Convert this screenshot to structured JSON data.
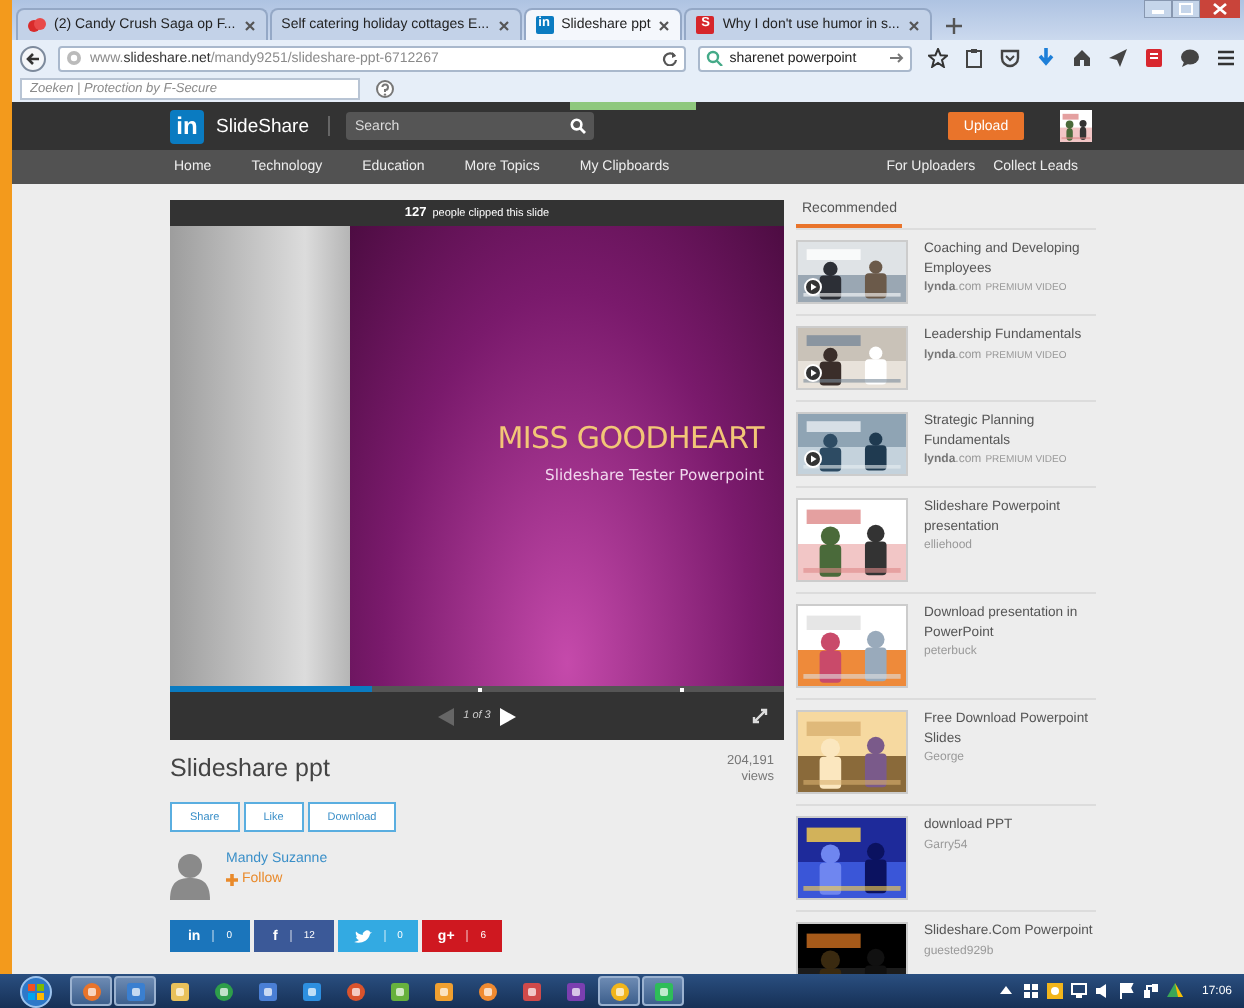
{
  "browser": {
    "tabs": [
      {
        "title": "(2) Candy Crush Saga op F...",
        "selected": false
      },
      {
        "title": "Self catering holiday cottages E...",
        "selected": false
      },
      {
        "title": "Slideshare ppt",
        "badge_text": "in",
        "selected": true
      },
      {
        "title": "Why I don't use humor in s...",
        "badge_text": "S",
        "selected": false
      }
    ],
    "address": "www.**slideshare.net**/mandy9251/slideshare-ppt-6712267",
    "search_value": "sharenet powerpoint",
    "addon_placeholder": "Zoeken | Protection by F-Secure"
  },
  "site": {
    "logo_text": "in",
    "brand": "SlideShare",
    "search_placeholder": "Search",
    "upload": "Upload",
    "nav": [
      "Home",
      "Technology",
      "Education",
      "More Topics",
      "My Clipboards"
    ],
    "nav_right": [
      "For Uploaders",
      "Collect Leads"
    ]
  },
  "player": {
    "clip_count": "127",
    "clip_text": "people clipped this slide",
    "slide_title": "MISS GOODHEART",
    "slide_subtitle": "Slideshare Tester Powerpoint",
    "level": 0.33,
    "page": "1 of 3"
  },
  "presentation": {
    "title": "Slideshare ppt",
    "views": "204,191",
    "views_label": "views",
    "actions": [
      "Share",
      "Like",
      "Download"
    ],
    "author": "Mandy Suzanne",
    "follow": "Follow",
    "social": [
      {
        "kind": "linkedin",
        "glyph": "in",
        "count": "0",
        "color": "#1b75bb"
      },
      {
        "kind": "facebook",
        "glyph": "f",
        "count": "12",
        "color": "#3b5998"
      },
      {
        "kind": "twitter",
        "count": "0",
        "color": "#33aae2"
      },
      {
        "kind": "google",
        "glyph": "g+",
        "count": "6",
        "color": "#cf1820"
      }
    ]
  },
  "recommended": {
    "tab": "Recommended",
    "items": [
      {
        "title": "Coaching and Developing Employees",
        "byline": "**lynda**.com",
        "badge": "PREMIUM VIDEO",
        "video": true
      },
      {
        "title": "Leadership Fundamentals",
        "byline": "**lynda**.com",
        "badge": "PREMIUM VIDEO",
        "video": true
      },
      {
        "title": "Strategic Planning Fundamentals",
        "byline": "**lynda**.com",
        "badge": "PREMIUM VIDEO",
        "video": true
      },
      {
        "title": "Slideshare Powerpoint presentation",
        "byline": "elliehood",
        "video": false
      },
      {
        "title": "Download presentation in PowerPoint",
        "byline": "peterbuck",
        "video": false
      },
      {
        "title": "Free Download Powerpoint Slides",
        "byline": "George",
        "video": false
      },
      {
        "title": "download PPT",
        "byline": "Garry54",
        "video": false
      },
      {
        "title": "Slideshare.Com Powerpoint",
        "byline": "guested929b",
        "video": false
      }
    ]
  },
  "taskbar": {
    "apps": [
      {
        "open": true
      },
      {
        "open": true
      },
      {
        "open": false
      },
      {
        "open": false
      },
      {
        "open": false
      },
      {
        "open": false
      },
      {
        "open": false
      },
      {
        "open": false
      },
      {
        "open": false
      },
      {
        "open": false
      },
      {
        "open": false
      },
      {
        "open": false
      },
      {
        "open": true
      },
      {
        "open": true
      }
    ],
    "clock": "17:06"
  }
}
